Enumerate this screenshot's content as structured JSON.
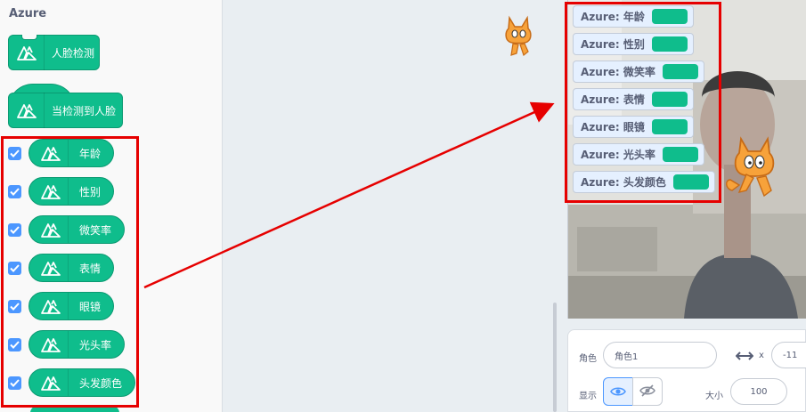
{
  "palette": {
    "category_title": "Azure",
    "command_block": {
      "label": "人脸检测"
    },
    "hat_block": {
      "label": "当检测到人脸"
    },
    "reporters": [
      {
        "label": "年龄",
        "checked": true
      },
      {
        "label": "性别",
        "checked": true
      },
      {
        "label": "微笑率",
        "checked": true
      },
      {
        "label": "表情",
        "checked": true
      },
      {
        "label": "眼镜",
        "checked": true
      },
      {
        "label": "光头率",
        "checked": true
      },
      {
        "label": "头发颜色",
        "checked": true
      }
    ]
  },
  "stage": {
    "monitors": [
      {
        "label": "Azure: 年龄"
      },
      {
        "label": "Azure: 性别"
      },
      {
        "label": "Azure: 微笑率"
      },
      {
        "label": "Azure: 表情"
      },
      {
        "label": "Azure: 眼镜"
      },
      {
        "label": "Azure: 光头率"
      },
      {
        "label": "Azure: 头发颜色"
      }
    ]
  },
  "sprite_info": {
    "sprite_label": "角色",
    "sprite_name": "角色1",
    "x_label": "x",
    "x_value": "-11",
    "show_label": "显示",
    "size_label": "大小",
    "size_value": "100"
  },
  "colors": {
    "extension_green": "#0fbd8c",
    "highlight_red": "#e60000",
    "checkbox_blue": "#4c97ff"
  },
  "icons": [
    "azure-extension-icon",
    "checkbox-checked-icon",
    "eye-icon",
    "eye-slash-icon",
    "horizontal-arrow-icon",
    "scratch-cat-icon"
  ]
}
